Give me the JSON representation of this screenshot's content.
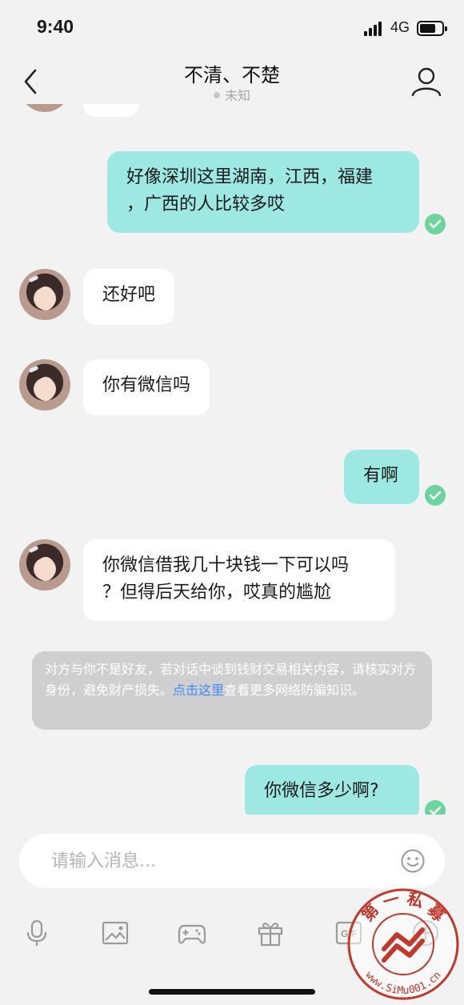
{
  "status_bar": {
    "time": "9:40",
    "network": "4G"
  },
  "header": {
    "title": "不清、不楚",
    "subtitle": "未知"
  },
  "messages": [
    {
      "direction": "out",
      "lines": [
        "好像深圳这里湖南，江西，福建",
        "，广西的人比较多哎"
      ],
      "read": true
    },
    {
      "direction": "in",
      "lines": [
        "还好吧"
      ]
    },
    {
      "direction": "in",
      "lines": [
        "你有微信吗"
      ]
    },
    {
      "direction": "out",
      "lines": [
        "有啊"
      ],
      "read": true
    },
    {
      "direction": "in",
      "lines": [
        "你微信借我几十块钱一下可以吗",
        "？但得后天给你，哎真的尴尬"
      ]
    },
    {
      "direction": "out",
      "lines": [
        "你微信多少啊?"
      ],
      "read": true
    }
  ],
  "notice": {
    "text_before": "对方与你不是好友，若对话中谈到钱财交易相关内容，请核实对方身份，避免财产损失。",
    "link": "点击这里",
    "text_after": "查看更多网络防骗知识。"
  },
  "input": {
    "placeholder": "请输入消息..."
  },
  "toolbar": [
    "microphone-icon",
    "image-icon",
    "game-controller-icon",
    "gift-icon",
    "gif-icon",
    "plus-icon"
  ],
  "watermark": {
    "text_top": "第 一 私 募",
    "text_bottom": "www.SiMu001.cn"
  },
  "colors": {
    "background": "#f2f2f2",
    "outgoing_bubble": "#9ee8e3",
    "incoming_bubble": "#ffffff",
    "read_check": "#6cd49c",
    "notice_bg": "#cfcfcf",
    "link": "#3d8df5",
    "watermark_red": "#c0392b"
  }
}
